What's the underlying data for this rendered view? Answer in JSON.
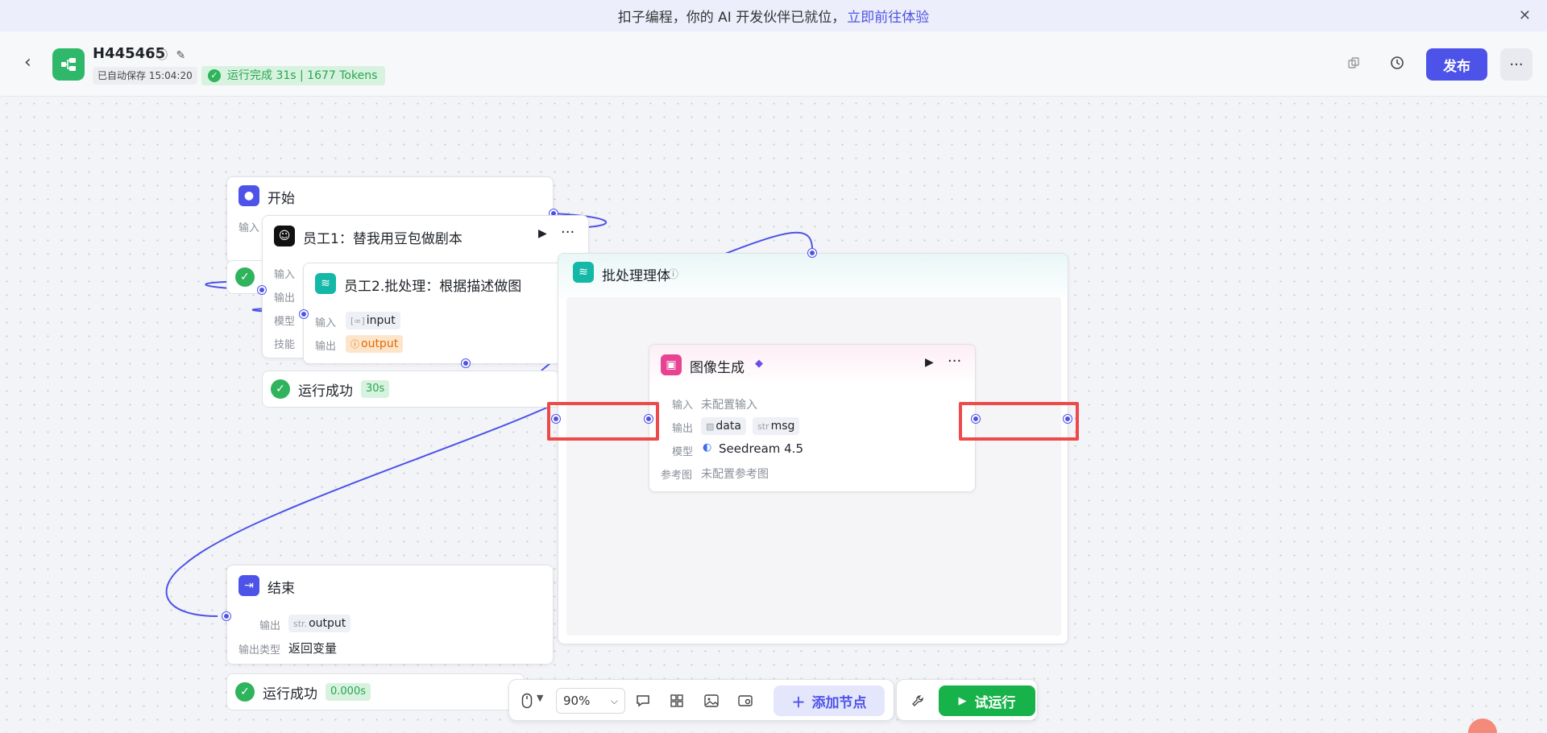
{
  "banner": {
    "text": "扣子编程，你的 AI 开发伙伴已就位，",
    "link": "立即前往体验",
    "close": "✕"
  },
  "header": {
    "back": "‹",
    "project_name": "H445465",
    "autosave": "已自动保存 15:04:20",
    "run_status": "运行完成 31s | 1677 Tokens",
    "publish": "发布",
    "more": "···"
  },
  "nodes": {
    "start": {
      "title": "开始",
      "input_label": "输入"
    },
    "worker1": {
      "title": "员工1：替我用豆包做剧本",
      "labels": [
        "输入",
        "输出",
        "模型",
        "技能"
      ],
      "success": "运行成功",
      "time": "30s"
    },
    "worker2": {
      "title": "员工2.批处理：根据描述做图",
      "input_label": "输入",
      "input_tag": "input",
      "output_label": "输出",
      "output_tag": "output"
    },
    "batch": {
      "title": "批处理理体"
    },
    "image_gen": {
      "title": "图像生成",
      "input_label": "输入",
      "input_value": "未配置输入",
      "output_label": "输出",
      "output_tag1": "data",
      "output_tag2_prefix": "str",
      "output_tag2": "msg",
      "model_label": "模型",
      "model_value": "Seedream 4.5",
      "ref_label": "参考图",
      "ref_value": "未配置参考图"
    },
    "end": {
      "title": "结束",
      "output_label": "输出",
      "output_prefix": "str.",
      "output_tag": "output",
      "type_label": "输出类型",
      "type_value": "返回变量",
      "success": "运行成功",
      "time": "0.000s"
    },
    "start_success": {
      "success": "运行成功"
    }
  },
  "toolbar": {
    "zoom": "90%",
    "add_node": "添加节点",
    "test_run": "试运行"
  },
  "colors": {
    "accent": "#4d53e8",
    "success": "#2fb35c",
    "highlight": "#ee4a4a"
  }
}
